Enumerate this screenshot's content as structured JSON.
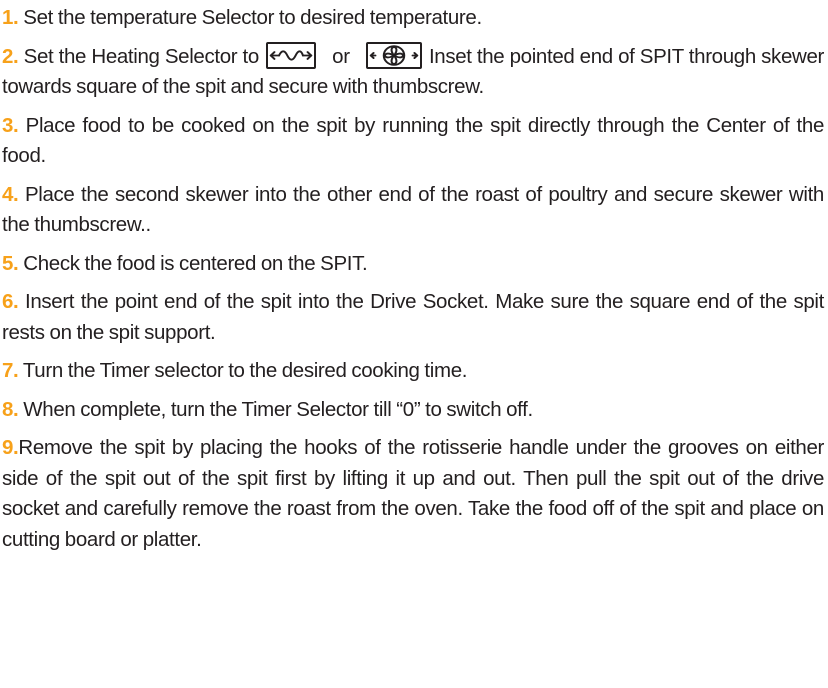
{
  "accent_color": "#f7a11a",
  "text_color": "#231f20",
  "steps": [
    {
      "num": "1.",
      "text": "Set the temperature Selector to desired temperature."
    },
    {
      "num": "2.",
      "text_before": "Set the Heating Selector to",
      "or": "or",
      "text_after": "Inset the pointed end of SPIT through skewer towards square of the spit and secure with thumbscrew.",
      "icons": [
        "heating-element-icon",
        "convection-fan-icon"
      ]
    },
    {
      "num": "3.",
      "text": "Place food to be cooked on the spit by running the spit directly through the Center of the food."
    },
    {
      "num": "4.",
      "text": "Place the second skewer into the other end of the roast of poultry and secure skewer with the thumbscrew.."
    },
    {
      "num": "5.",
      "text": "Check the food is centered on the SPIT."
    },
    {
      "num": "6.",
      "text": "Insert the point end of the spit into the Drive Socket. Make sure the square end of the spit rests on the spit support."
    },
    {
      "num": "7.",
      "text": "Turn the Timer selector to the desired cooking time."
    },
    {
      "num": "8.",
      "text": "When complete, turn the Timer Selector till “0” to switch off."
    },
    {
      "num": "9.",
      "text": "Remove the spit by placing the hooks of the rotisserie handle under the grooves on either side of the spit out of the spit first by lifting it up and out. Then pull the spit out of the drive socket and carefully remove the roast from the oven. Take the food off of the spit and place on cutting board or platter."
    }
  ]
}
